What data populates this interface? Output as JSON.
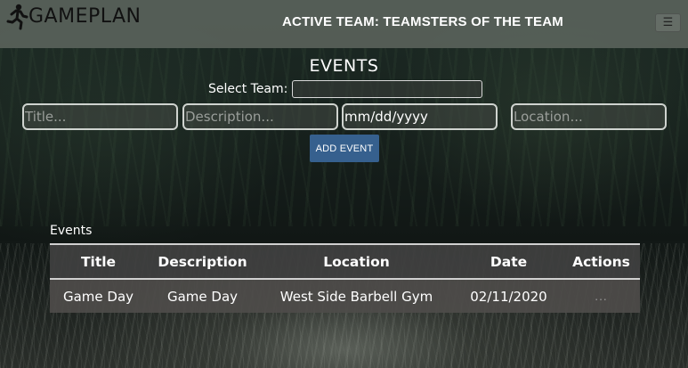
{
  "brand": {
    "name": "GAMEPLAN",
    "icon": "running-person-icon"
  },
  "header": {
    "active_team": "ACTIVE TEAM: TEAMSTERS OF THE TEAM",
    "menu_icon": "☰"
  },
  "events_form": {
    "heading": "EVENTS",
    "select_label": "Select Team:",
    "select_value": "",
    "title_placeholder": "Title...",
    "description_placeholder": "Description...",
    "date_value": "mm/dd/yyyy",
    "location_placeholder": "Location...",
    "add_button": "ADD EVENT"
  },
  "events_table": {
    "caption": "Events",
    "columns": [
      "Title",
      "Description",
      "Location",
      "Date",
      "Actions"
    ],
    "rows": [
      {
        "title": "Game Day",
        "description": "Game Day",
        "location": "West Side Barbell Gym",
        "date": "02/11/2020",
        "actions": "..."
      }
    ]
  },
  "colors": {
    "navbar": "#646c64",
    "button": "#36608e",
    "table_header": "#404040",
    "table_row": "#4e4c4a"
  }
}
